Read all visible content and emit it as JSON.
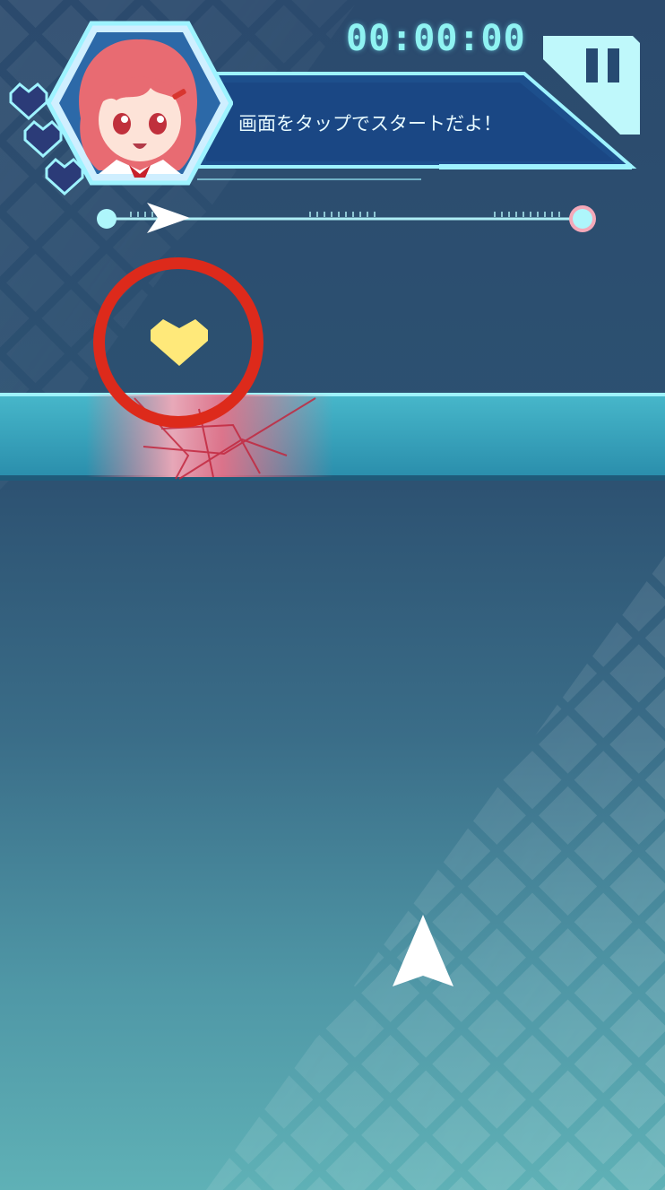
{
  "hud": {
    "timer": "00:00:00",
    "pause_icon": "pause-icon",
    "message": "画面をタップでスタートだよ！",
    "lives": {
      "count": 3,
      "icon": "heart-icon",
      "color": "#2b3b78"
    }
  },
  "progress": {
    "value": 0.0,
    "marker_icon": "arrow-right-icon"
  },
  "game": {
    "target_icon": "heart-icon",
    "target_color": "#ffe97a",
    "player_icon": "arrow-up-icon",
    "highlight_color": "#dd2a1b"
  },
  "colors": {
    "accent_cyan": "#8ff3f2",
    "panel_blue": "#1d4f8c",
    "lane_teal": "#2f9fba",
    "hit_pink": "#ef6f86"
  }
}
